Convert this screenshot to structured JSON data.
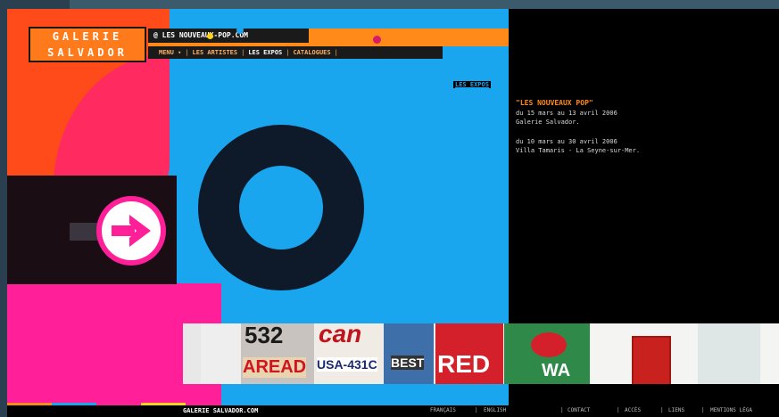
{
  "header": {
    "logo_line1": "GALERIE",
    "logo_line2": "SALVADOR",
    "url": "@ LES NOUVEAUX-POP.COM",
    "nav": [
      {
        "label": "MENU ▾"
      },
      {
        "label": "LES ARTISTES"
      },
      {
        "label": "LES EXPOS"
      },
      {
        "label": "CATALOGUES"
      }
    ],
    "nav_separator": "|"
  },
  "section_tag": "LES EXPOS",
  "expo": {
    "title": "\"LES NOUVEAUX POP\"",
    "line1": "du 15 mars au 13 avril 2006",
    "line2": "Galerie Salvador.",
    "line3": "du 10 mars au 30 avril 2006",
    "line4": "Villa Tamaris - La Seyne-sur-Mer."
  },
  "thumbnails": [
    {
      "text": "532"
    },
    {
      "text": "AREAD"
    },
    {
      "text": "can"
    },
    {
      "text": "USA-431C"
    },
    {
      "text": "BEST"
    },
    {
      "text": "RED"
    },
    {
      "text": "WA"
    }
  ],
  "footer": {
    "site": "GALERIE SALVADOR.COM",
    "lang_fr": "FRANÇAIS",
    "lang_en": "ENGLISH",
    "contact": "CONTACT",
    "acces": "ACCÈS",
    "liens": "LIENS",
    "mentions": "MENTIONS LÉGA",
    "separator": "|"
  },
  "colors": {
    "orange": "#ff8a1a",
    "blue": "#19a6ef",
    "pink": "#ff1f98",
    "black": "#000000"
  },
  "icons": {
    "arrow": "arrow-right-icon",
    "ring": "ring-o-shape"
  }
}
